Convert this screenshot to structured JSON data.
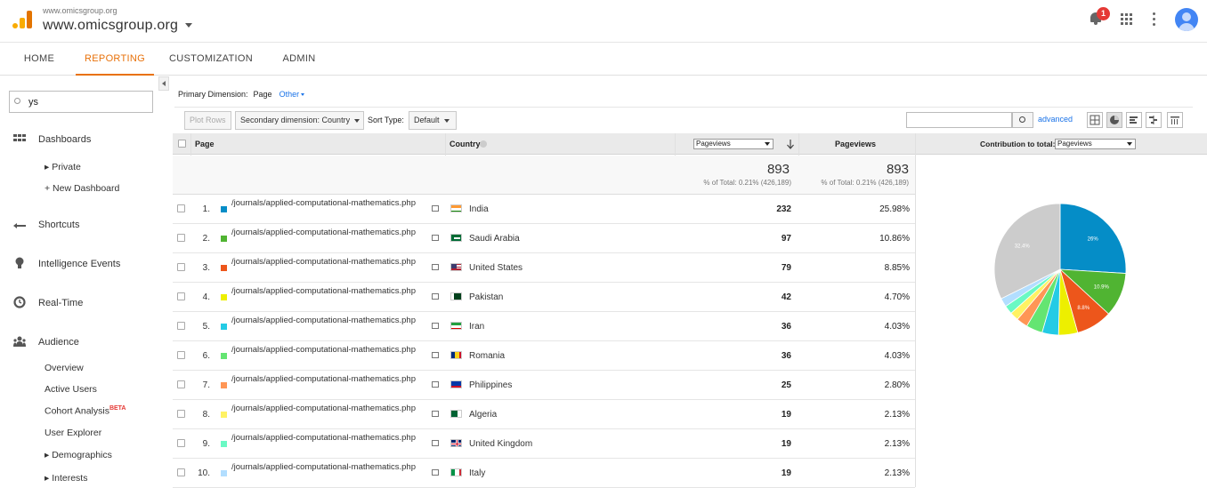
{
  "header": {
    "account_url_small": "www.omicsgroup.org",
    "account_url": "www.omicsgroup.org",
    "notification_count": "1"
  },
  "tabs": [
    {
      "label": "HOME"
    },
    {
      "label": "REPORTING",
      "active": true
    },
    {
      "label": "CUSTOMIZATION"
    },
    {
      "label": "ADMIN"
    }
  ],
  "sidebar": {
    "search_value": "ys",
    "sections": {
      "dashboards": "Dashboards",
      "private": "▸ Private",
      "new_dashboard": "+ New Dashboard",
      "shortcuts": "Shortcuts",
      "intelligence": "Intelligence Events",
      "realtime": "Real-Time",
      "audience": "Audience",
      "overview": "Overview",
      "active_users": "Active Users",
      "cohort": "Cohort Analysis",
      "cohort_badge": "BETA",
      "user_explorer": "User Explorer",
      "demographics": "▸ Demographics",
      "interests": "▸ Interests"
    }
  },
  "report": {
    "primary_dimension_label": "Primary Dimension:",
    "primary_dimension_value": "Page",
    "primary_dimension_other": "Other",
    "plot_rows": "Plot Rows",
    "secondary_dimension": "Secondary dimension: Country",
    "sort_type_label": "Sort Type:",
    "sort_type_value": "Default",
    "advanced": "advanced",
    "columns": {
      "page": "Page",
      "country": "Country",
      "metric_select": "Pageviews",
      "pageviews": "Pageviews",
      "contribution_label": "Contribution to total:",
      "contribution_select": "Pageviews"
    },
    "totals": {
      "pageviews_1": "893",
      "pct_1": "% of Total: 0.21% (426,189)",
      "pageviews_2": "893",
      "pct_2": "% of Total: 0.21% (426,189)"
    },
    "rows": [
      {
        "n": "1.",
        "page": "/journals/applied-computational-mathematics.php",
        "country": "India",
        "pv": "232",
        "pct": "25.98%",
        "color": "#058dc7"
      },
      {
        "n": "2.",
        "page": "/journals/applied-computational-mathematics.php",
        "country": "Saudi Arabia",
        "pv": "97",
        "pct": "10.86%",
        "color": "#50b432"
      },
      {
        "n": "3.",
        "page": "/journals/applied-computational-mathematics.php",
        "country": "United States",
        "pv": "79",
        "pct": "8.85%",
        "color": "#ed561b"
      },
      {
        "n": "4.",
        "page": "/journals/applied-computational-mathematics.php",
        "country": "Pakistan",
        "pv": "42",
        "pct": "4.70%",
        "color": "#edef00"
      },
      {
        "n": "5.",
        "page": "/journals/applied-computational-mathematics.php",
        "country": "Iran",
        "pv": "36",
        "pct": "4.03%",
        "color": "#24cbe5"
      },
      {
        "n": "6.",
        "page": "/journals/applied-computational-mathematics.php",
        "country": "Romania",
        "pv": "36",
        "pct": "4.03%",
        "color": "#64e572"
      },
      {
        "n": "7.",
        "page": "/journals/applied-computational-mathematics.php",
        "country": "Philippines",
        "pv": "25",
        "pct": "2.80%",
        "color": "#ff9655"
      },
      {
        "n": "8.",
        "page": "/journals/applied-computational-mathematics.php",
        "country": "Algeria",
        "pv": "19",
        "pct": "2.13%",
        "color": "#fff263"
      },
      {
        "n": "9.",
        "page": "/journals/applied-computational-mathematics.php",
        "country": "United Kingdom",
        "pv": "19",
        "pct": "2.13%",
        "color": "#6af9c4"
      },
      {
        "n": "10.",
        "page": "/journals/applied-computational-mathematics.php",
        "country": "Italy",
        "pv": "19",
        "pct": "2.13%",
        "color": "#b2deff"
      }
    ]
  },
  "chart_data": {
    "type": "pie",
    "categories": [
      "India",
      "Saudi Arabia",
      "United States",
      "Pakistan",
      "Iran",
      "Romania",
      "Philippines",
      "Algeria",
      "United Kingdom",
      "Italy",
      "Other"
    ],
    "values": [
      25.98,
      10.86,
      8.85,
      4.7,
      4.03,
      4.03,
      2.8,
      2.13,
      2.13,
      2.13,
      32.36
    ],
    "colors": [
      "#058dc7",
      "#50b432",
      "#ed561b",
      "#edef00",
      "#24cbe5",
      "#64e572",
      "#ff9655",
      "#fff263",
      "#6af9c4",
      "#b2deff",
      "#cccccc"
    ],
    "data_labels": [
      "26%",
      "10.9%",
      "8.8%",
      "",
      "",
      "",
      "",
      "",
      "",
      "",
      "32.4%"
    ]
  }
}
